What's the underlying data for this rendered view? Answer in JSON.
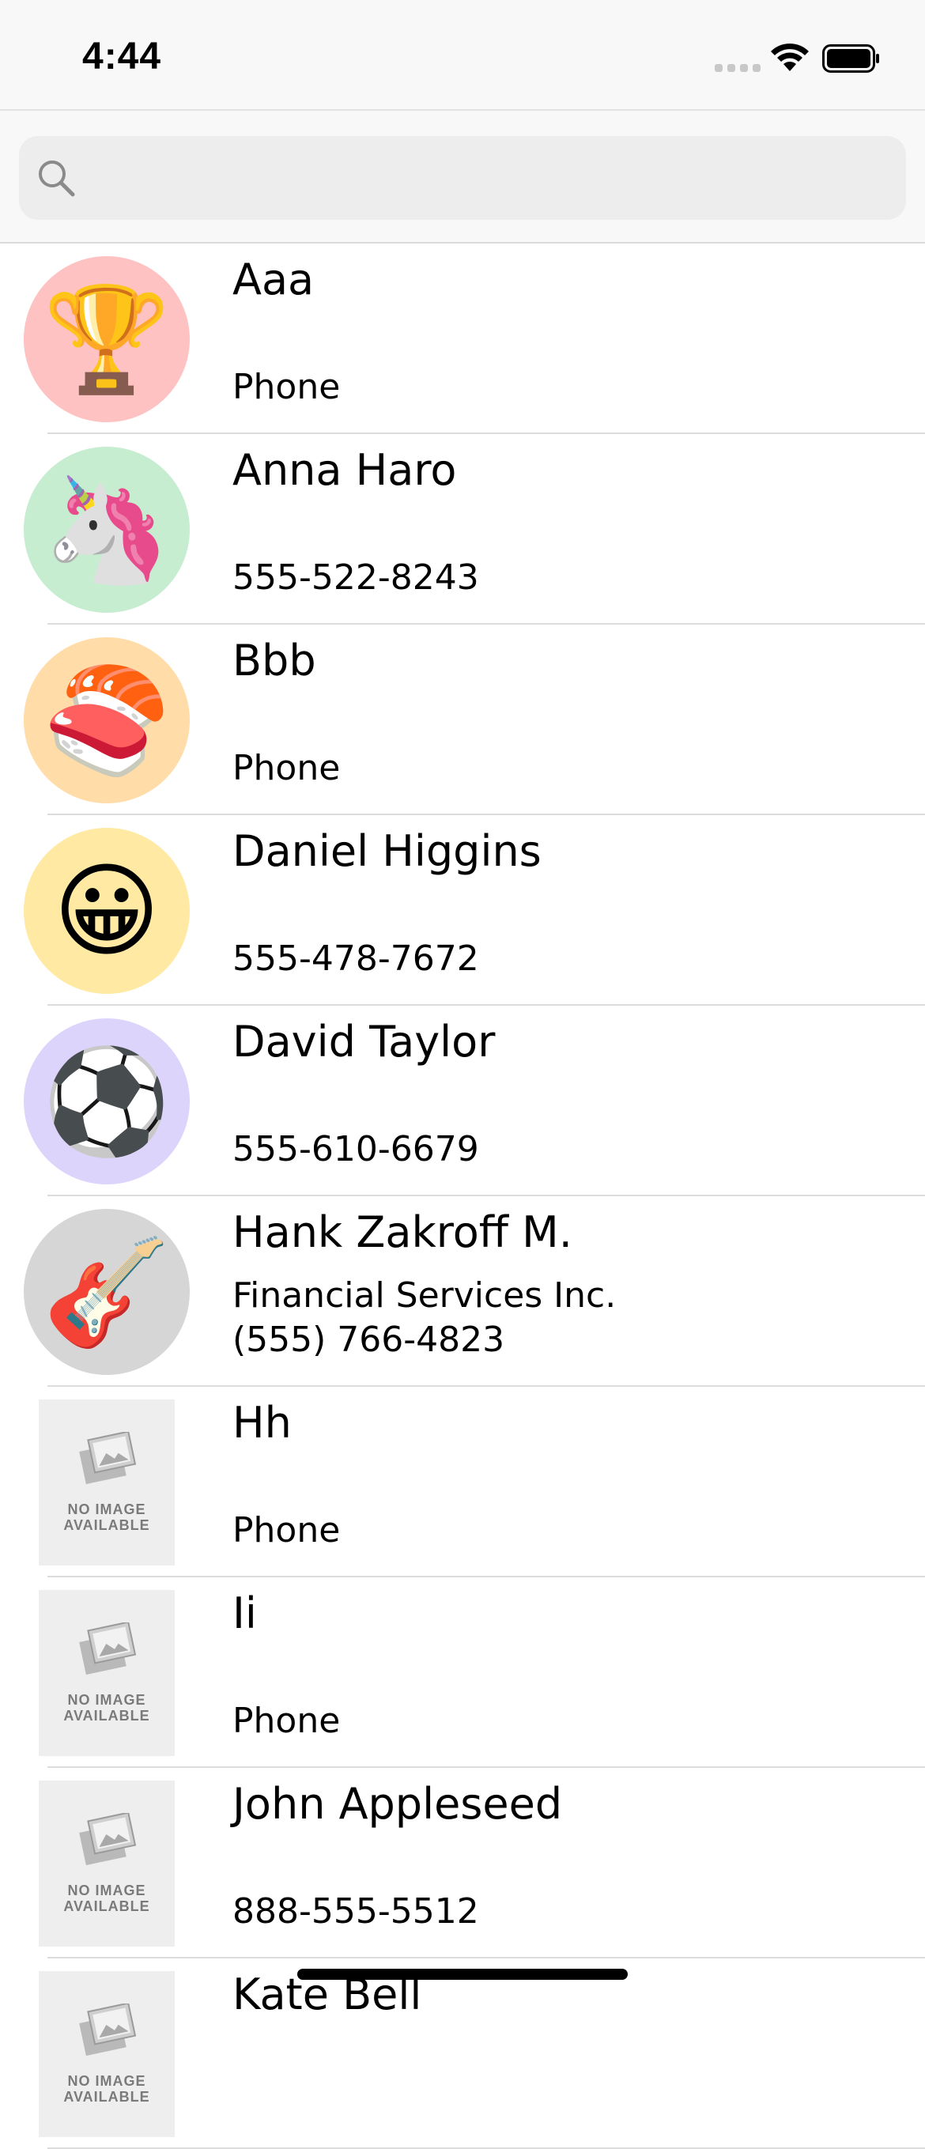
{
  "status_bar": {
    "time": "4:44"
  },
  "search": {
    "placeholder": "",
    "icon": "search-icon"
  },
  "contacts": [
    {
      "name": "Aaa",
      "company": "",
      "phone": "Phone",
      "avatar_emoji": "🏆",
      "avatar_bg": "#ffc2c2",
      "avatar_icon": "trophy-icon"
    },
    {
      "name": "Anna Haro",
      "company": "",
      "phone": "555-522-8243",
      "avatar_emoji": "🦄",
      "avatar_bg": "#c6edd0",
      "avatar_icon": "unicorn-icon"
    },
    {
      "name": "Bbb",
      "company": "",
      "phone": "Phone",
      "avatar_emoji": "🍣",
      "avatar_bg": "#ffdca8",
      "avatar_icon": "sushi-icon"
    },
    {
      "name": "Daniel Higgins",
      "company": "",
      "phone": "555-478-7672",
      "avatar_emoji": "😀",
      "avatar_bg": "#ffe9a3",
      "avatar_icon": "smiley-icon"
    },
    {
      "name": "David Taylor",
      "company": "",
      "phone": "555-610-6679",
      "avatar_emoji": "⚽",
      "avatar_bg": "#dcd4fb",
      "avatar_icon": "soccer-ball-icon"
    },
    {
      "name": "Hank Zakroff M.",
      "company": "Financial Services Inc.",
      "phone": "(555) 766-4823",
      "avatar_emoji": "🎸",
      "avatar_bg": "#d6d6d6",
      "avatar_icon": "guitar-icon"
    },
    {
      "name": "Hh",
      "company": "",
      "phone": "Phone",
      "placeholder_text": "NO IMAGE\nAVAILABLE",
      "avatar_icon": "no-image-icon"
    },
    {
      "name": "Ii",
      "company": "",
      "phone": "Phone",
      "placeholder_text": "NO IMAGE\nAVAILABLE",
      "avatar_icon": "no-image-icon"
    },
    {
      "name": "John Appleseed",
      "company": "",
      "phone": "888-555-5512",
      "placeholder_text": "NO IMAGE\nAVAILABLE",
      "avatar_icon": "no-image-icon"
    },
    {
      "name": "Kate Bell",
      "company": "",
      "phone": "",
      "placeholder_text": "NO IMAGE\nAVAILABLE",
      "avatar_icon": "no-image-icon"
    }
  ]
}
